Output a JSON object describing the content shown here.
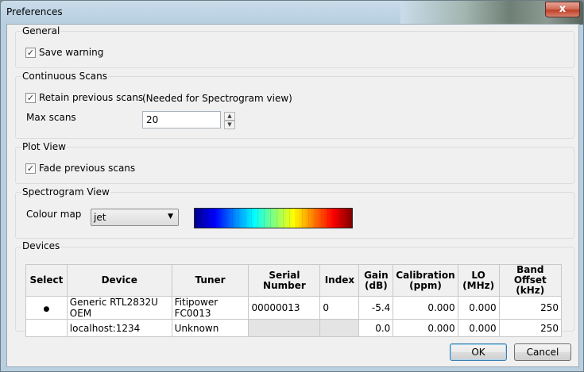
{
  "window": {
    "title": "Preferences",
    "close_glyph": "x"
  },
  "general": {
    "title": "General",
    "save_warning": {
      "label": "Save warning",
      "checked": true
    }
  },
  "continuous_scans": {
    "title": "Continuous Scans",
    "retain": {
      "label": "Retain previous scans",
      "checked": true
    },
    "note": "(Needed for Spectrogram view)",
    "max_scans_label": "Max scans",
    "max_scans_value": "20"
  },
  "plot_view": {
    "title": "Plot View",
    "fade": {
      "label": "Fade previous scans",
      "checked": true
    }
  },
  "spectrogram_view": {
    "title": "Spectrogram View",
    "colour_map_label": "Colour map",
    "colour_map_value": "jet",
    "colormap_colors": [
      "#00008f",
      "#0000ff",
      "#0080ff",
      "#00ffff",
      "#80ff80",
      "#ffff00",
      "#ff8000",
      "#ff0000",
      "#800000"
    ]
  },
  "devices": {
    "title": "Devices",
    "columns": [
      "Select",
      "Device",
      "Tuner",
      "Serial Number",
      "Index",
      "Gain\n(dB)",
      "Calibration\n(ppm)",
      "LO\n(MHz)",
      "Band Offset\n(kHz)"
    ],
    "rows": [
      {
        "selected": true,
        "device": "Generic RTL2832U OEM",
        "tuner": "Fitipower FC0013",
        "serial": "00000013",
        "index": "0",
        "gain": "-5.4",
        "calibration": "0.000",
        "lo": "0.000",
        "band_offset": "250"
      },
      {
        "selected": false,
        "device": "localhost:1234",
        "tuner": "Unknown",
        "serial": "",
        "index": "",
        "gain": "0.0",
        "calibration": "0.000",
        "lo": "0.000",
        "band_offset": "250"
      }
    ]
  },
  "buttons": {
    "ok": "OK",
    "cancel": "Cancel"
  }
}
